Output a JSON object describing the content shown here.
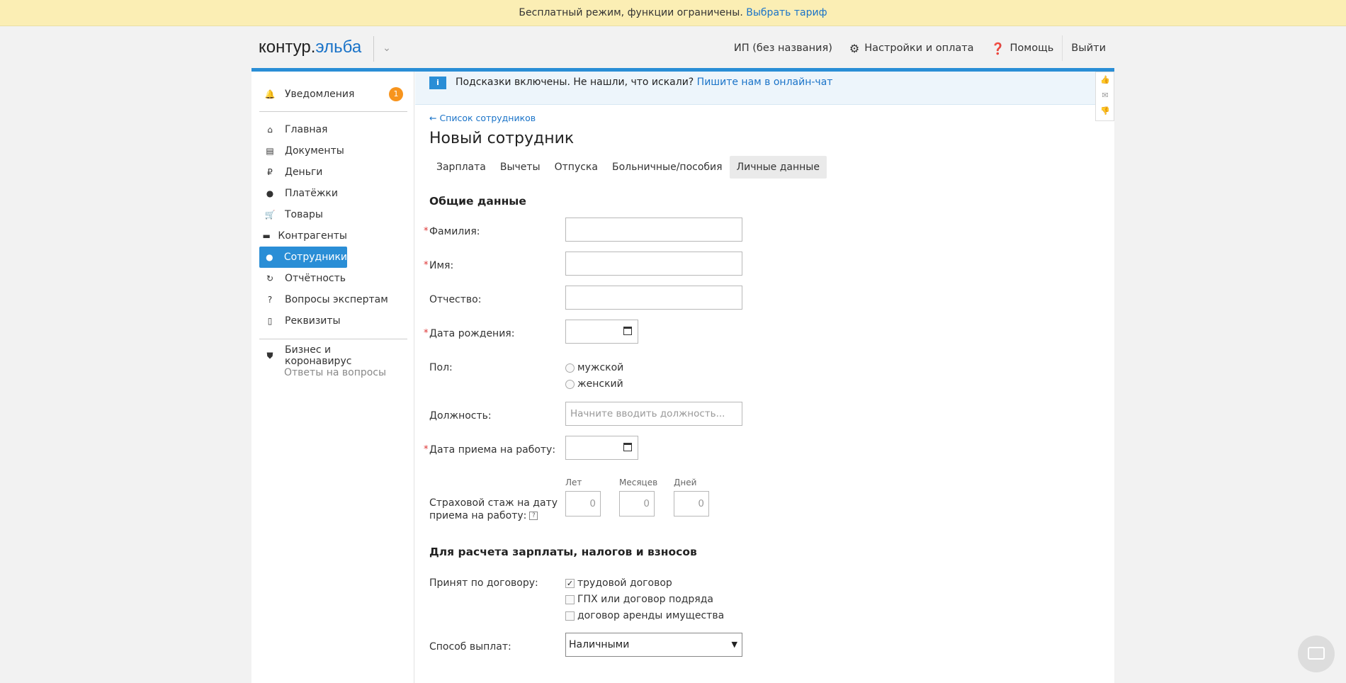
{
  "banner": {
    "text": "Бесплатный режим, функции ограничены.",
    "link": "Выбрать тариф"
  },
  "header": {
    "logo_main": "контур.",
    "logo_accent": "эльба",
    "org": "ИП (без названия)",
    "settings": "Настройки и оплата",
    "help": "Помощь",
    "logout": "Выйти"
  },
  "sidebar": {
    "notifications": "Уведомления",
    "notifications_count": "1",
    "items": [
      {
        "label": "Главная",
        "icon": "home-icon"
      },
      {
        "label": "Документы",
        "icon": "documents-icon"
      },
      {
        "label": "Деньги",
        "icon": "money-icon"
      },
      {
        "label": "Платёжки",
        "icon": "payments-icon"
      },
      {
        "label": "Товары",
        "icon": "cart-icon"
      },
      {
        "label": "Контрагенты",
        "icon": "briefcase-icon"
      },
      {
        "label": "Сотрудники",
        "icon": "user-icon"
      },
      {
        "label": "Отчётность",
        "icon": "reports-icon"
      },
      {
        "label": "Вопросы экспертам",
        "icon": "question-icon"
      },
      {
        "label": "Реквизиты",
        "icon": "requisites-icon"
      }
    ],
    "covid": "Бизнес и коронавирус",
    "covid_sub": "Ответы на вопросы"
  },
  "hint": {
    "text": "Подсказки включены. Не нашли, что искали?",
    "link": "Пишите нам в онлайн-чат",
    "icon_letter": "i"
  },
  "page": {
    "back": "← Список сотрудников",
    "title": "Новый сотрудник",
    "tabs": [
      "Зарплата",
      "Вычеты",
      "Отпуска",
      "Больничные/пособия",
      "Личные данные"
    ]
  },
  "form": {
    "section1": "Общие данные",
    "last_name": "Фамилия:",
    "first_name": "Имя:",
    "middle_name": "Отчество:",
    "birth_date": "Дата рождения:",
    "gender": "Пол:",
    "gender_male": "мужской",
    "gender_female": "женский",
    "position": "Должность:",
    "position_placeholder": "Начните вводить должность...",
    "hire_date": "Дата приема на работу:",
    "insurance_label_1": "Страховой стаж на дату",
    "insurance_label_2": "приема на работу:",
    "years": "Лет",
    "months": "Месяцев",
    "days": "Дней",
    "years_val": "0",
    "months_val": "0",
    "days_val": "0",
    "section2": "Для расчета зарплаты, налогов и взносов",
    "contract": "Принят по договору:",
    "contract_labor": "трудовой договор",
    "contract_gph": "ГПХ или договор подряда",
    "contract_rent": "договор аренды имущества",
    "pay_method": "Способ выплат:",
    "pay_method_value": "Наличными"
  }
}
